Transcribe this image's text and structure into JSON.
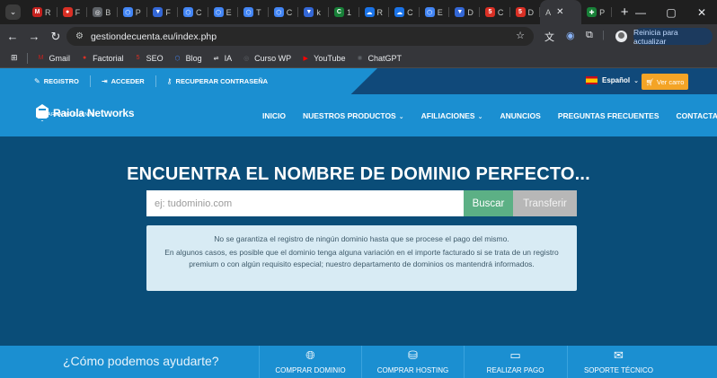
{
  "browser": {
    "tabs": [
      {
        "letter": "R",
        "color": "#c5221f",
        "fav": "M"
      },
      {
        "letter": "F",
        "color": "#d93025",
        "fav": "●"
      },
      {
        "letter": "B",
        "color": "#5f6368",
        "fav": "◎"
      },
      {
        "letter": "P",
        "color": "#4285f4",
        "fav": "⬡"
      },
      {
        "letter": "F",
        "color": "#3367d6",
        "fav": "▼"
      },
      {
        "letter": "C",
        "color": "#4285f4",
        "fav": "⬡"
      },
      {
        "letter": "E",
        "color": "#4285f4",
        "fav": "⬡"
      },
      {
        "letter": "T",
        "color": "#4285f4",
        "fav": "⬡"
      },
      {
        "letter": "C",
        "color": "#4285f4",
        "fav": "⬡"
      },
      {
        "letter": "k",
        "color": "#3367d6",
        "fav": "▼"
      },
      {
        "letter": "1",
        "color": "#188038",
        "fav": "C"
      },
      {
        "letter": "R",
        "color": "#1a73e8",
        "fav": "☁"
      },
      {
        "letter": "C",
        "color": "#1a73e8",
        "fav": "☁"
      },
      {
        "letter": "E",
        "color": "#4285f4",
        "fav": "⬡"
      },
      {
        "letter": "D",
        "color": "#3367d6",
        "fav": "▼"
      },
      {
        "letter": "C",
        "color": "#d93025",
        "fav": "5"
      },
      {
        "letter": "D",
        "color": "#d93025",
        "fav": "5"
      }
    ],
    "active_tab": {
      "letter": "A"
    },
    "extra_tab": {
      "letter": "P",
      "color": "#188038",
      "fav": "✚"
    },
    "url": "gestiondecuenta.eu/index.php",
    "update_label": "Reinicia para actualizar",
    "bookmarks": [
      {
        "label": "Gmail",
        "icon": "gmail-icon",
        "color": "#c5221f",
        "glyph": "M"
      },
      {
        "label": "Factorial",
        "icon": "factorial-icon",
        "color": "#d93025",
        "glyph": "●"
      },
      {
        "label": "SEO",
        "icon": "seo-icon",
        "color": "#d93025",
        "glyph": "5"
      },
      {
        "label": "Blog",
        "icon": "blog-icon",
        "color": "#4285f4",
        "glyph": "⬡"
      },
      {
        "label": "IA",
        "icon": "ia-icon",
        "color": "#e8eaed",
        "glyph": "⇌"
      },
      {
        "label": "Curso WP",
        "icon": "wp-icon",
        "color": "#5f6368",
        "glyph": "◎"
      },
      {
        "label": "YouTube",
        "icon": "youtube-icon",
        "color": "#ff0000",
        "glyph": "▶"
      },
      {
        "label": "ChatGPT",
        "icon": "chatgpt-icon",
        "color": "#5f6368",
        "glyph": "✺"
      }
    ]
  },
  "topbar": {
    "registro": "REGISTRO",
    "acceder": "ACCEDER",
    "recuperar": "RECUPERAR CONTRASEÑA",
    "language": "Español",
    "cart": "Ver carro"
  },
  "header": {
    "logo_name": "Raiola Networks",
    "logo_sub": "ÁREA DE CLIENTE",
    "nav": [
      {
        "label": "INICIO",
        "dropdown": false
      },
      {
        "label": "NUESTROS PRODUCTOS",
        "dropdown": true
      },
      {
        "label": "AFILIACIONES",
        "dropdown": true
      },
      {
        "label": "ANUNCIOS",
        "dropdown": false
      },
      {
        "label": "PREGUNTAS FRECUENTES",
        "dropdown": false
      },
      {
        "label": "CONTACTAR",
        "dropdown": false
      }
    ]
  },
  "hero": {
    "title": "ENCUENTRA EL NOMBRE DE DOMINIO PERFECTO...",
    "search_placeholder": "ej: tudominio.com",
    "search_button": "Buscar",
    "transfer_button": "Transferir"
  },
  "notice": {
    "line1": "No se garantiza el registro de ningún dominio hasta que se procese el pago del mismo.",
    "line2": "En algunos casos, es posible que el dominio tenga alguna variación en el importe facturado si se trata de un registro premium o con algún requisito especial; nuestro departamento de dominios os mantendrá informados."
  },
  "footer": {
    "help": "¿Cómo podemos ayudarte?",
    "actions": [
      {
        "label": "COMPRAR DOMINIO",
        "icon": "globe-icon"
      },
      {
        "label": "COMPRAR HOSTING",
        "icon": "server-icon"
      },
      {
        "label": "REALIZAR PAGO",
        "icon": "credit-card-icon"
      },
      {
        "label": "SOPORTE TÉCNICO",
        "icon": "envelope-icon"
      }
    ]
  }
}
